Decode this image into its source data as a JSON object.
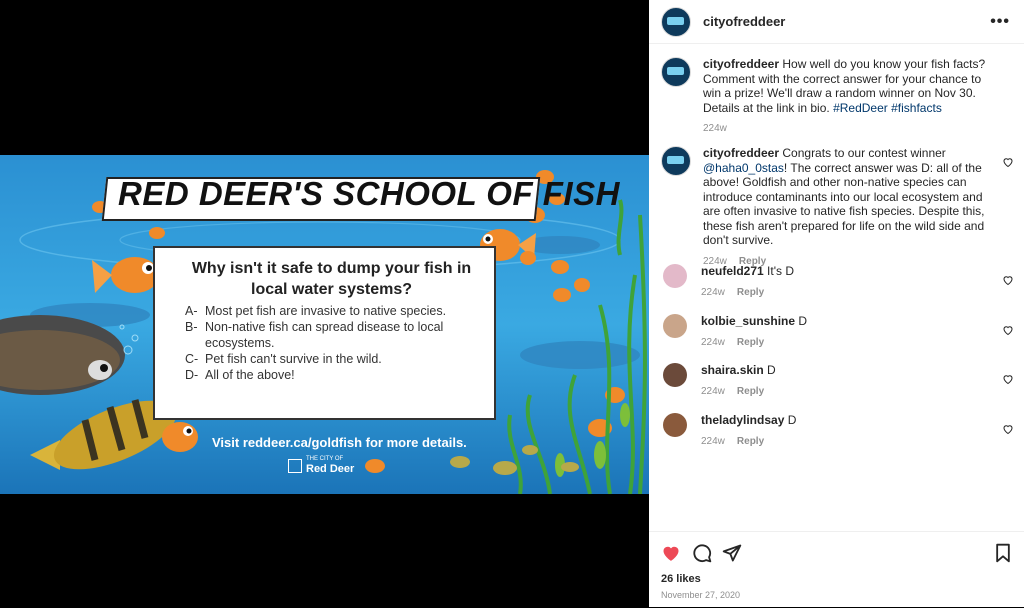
{
  "poster": {
    "banner": "RED DEER'S SCHOOL OF FISH",
    "question": "Why isn't it safe to dump your fish in local water systems?",
    "options": [
      {
        "letter": "A-",
        "text": "Most pet fish are invasive to native species."
      },
      {
        "letter": "B-",
        "text": "Non-native fish can spread disease to local ecosystems."
      },
      {
        "letter": "C-",
        "text": "Pet fish can't survive in the wild."
      },
      {
        "letter": "D-",
        "text": "All of the above!"
      }
    ],
    "visit": "Visit reddeer.ca/goldfish for more details.",
    "logo_small": "THE CITY OF",
    "logo_big": "Red Deer"
  },
  "header": {
    "username": "cityofreddeer",
    "more": "•••"
  },
  "caption": {
    "username": "cityofreddeer",
    "text": "How well do you know your fish facts? Comment with the correct answer for your chance to win a prize! We'll draw a random winner on Nov 30. Details at the link in bio.",
    "tag1": "#RedDeer",
    "tag2": "#fishfacts",
    "age": "224w"
  },
  "comments": [
    {
      "username": "cityofreddeer",
      "text_pre": "Congrats to our contest winner ",
      "mention": "@haha0_0stas",
      "text_post": "! The correct answer was D: all of the above! Goldfish and other non-native species can introduce contaminants into our local ecosystem and are often invasive to native fish species. Despite this, these fish aren't prepared for life on the wild side and don't survive.",
      "age": "224w",
      "reply": "Reply"
    },
    {
      "username": "neufeld271",
      "text": "It's D",
      "age": "224w",
      "reply": "Reply",
      "color": "#e3b9c9"
    },
    {
      "username": "kolbie_sunshine",
      "text": "D",
      "age": "224w",
      "reply": "Reply",
      "color": "#c9a58a"
    },
    {
      "username": "shaira.skin",
      "text": "D",
      "age": "224w",
      "reply": "Reply",
      "color": "#6b4a3a"
    },
    {
      "username": "theladylindsay",
      "text": "D",
      "age": "224w",
      "reply": "Reply",
      "color": "#8a5a3c"
    }
  ],
  "footer": {
    "likes": "26 likes",
    "date": "November 27, 2020"
  },
  "colors": {
    "heart": "#ed4956",
    "link": "#00376b",
    "muted": "#8e8e8e"
  }
}
